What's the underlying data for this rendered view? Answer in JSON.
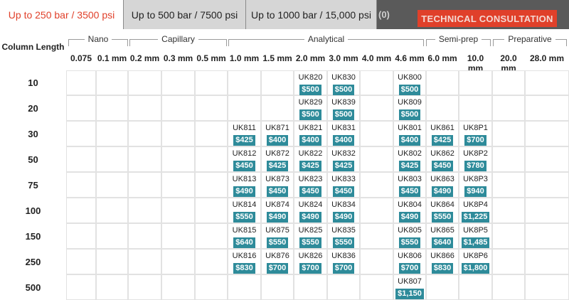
{
  "tabs": [
    {
      "label": "Up to 250 bar / 3500 psi",
      "active": true
    },
    {
      "label": "Up to 500 bar / 7500 psi",
      "active": false
    },
    {
      "label": "Up to 1000 bar / 15,000 psi",
      "active": false
    }
  ],
  "cart_count": "(0)",
  "consult_button": "TECHNICAL CONSULTATION",
  "column_length_label": "Column Length",
  "groups": [
    {
      "label": "Nano"
    },
    {
      "label": "Capillary"
    },
    {
      "label": "Analytical"
    },
    {
      "label": "Semi-prep"
    },
    {
      "label": "Preparative"
    }
  ],
  "columns": [
    "0.075",
    "0.1 mm",
    "0.2 mm",
    "0.3 mm",
    "0.5 mm",
    "1.0 mm",
    "1.5 mm",
    "2.0 mm",
    "3.0 mm",
    "4.0 mm",
    "4.6 mm",
    "6.0 mm",
    "10.0 mm",
    "20.0 mm",
    "28.0 mm"
  ],
  "price_color": "#2e8b9a",
  "accent_color": "#e0402a",
  "rows": [
    {
      "length": "10",
      "cells": [
        null,
        null,
        null,
        null,
        null,
        null,
        null,
        {
          "code": "UK820",
          "price": "$500"
        },
        {
          "code": "UK830",
          "price": "$500"
        },
        null,
        {
          "code": "UK800",
          "price": "$500"
        },
        null,
        null,
        null,
        null
      ]
    },
    {
      "length": "20",
      "cells": [
        null,
        null,
        null,
        null,
        null,
        null,
        null,
        {
          "code": "UK829",
          "price": "$500"
        },
        {
          "code": "UK839",
          "price": "$500"
        },
        null,
        {
          "code": "UK809",
          "price": "$500"
        },
        null,
        null,
        null,
        null
      ]
    },
    {
      "length": "30",
      "cells": [
        null,
        null,
        null,
        null,
        null,
        {
          "code": "UK811",
          "price": "$425"
        },
        {
          "code": "UK871",
          "price": "$400"
        },
        {
          "code": "UK821",
          "price": "$400"
        },
        {
          "code": "UK831",
          "price": "$400"
        },
        null,
        {
          "code": "UK801",
          "price": "$400"
        },
        {
          "code": "UK861",
          "price": "$425"
        },
        {
          "code": "UK8P1",
          "price": "$700"
        },
        null,
        null
      ]
    },
    {
      "length": "50",
      "cells": [
        null,
        null,
        null,
        null,
        null,
        {
          "code": "UK812",
          "price": "$450"
        },
        {
          "code": "UK872",
          "price": "$425"
        },
        {
          "code": "UK822",
          "price": "$425"
        },
        {
          "code": "UK832",
          "price": "$425"
        },
        null,
        {
          "code": "UK802",
          "price": "$425"
        },
        {
          "code": "UK862",
          "price": "$450"
        },
        {
          "code": "UK8P2",
          "price": "$780"
        },
        null,
        null
      ]
    },
    {
      "length": "75",
      "cells": [
        null,
        null,
        null,
        null,
        null,
        {
          "code": "UK813",
          "price": "$490"
        },
        {
          "code": "UK873",
          "price": "$450"
        },
        {
          "code": "UK823",
          "price": "$450"
        },
        {
          "code": "UK833",
          "price": "$450"
        },
        null,
        {
          "code": "UK803",
          "price": "$450"
        },
        {
          "code": "UK863",
          "price": "$490"
        },
        {
          "code": "UK8P3",
          "price": "$940"
        },
        null,
        null
      ]
    },
    {
      "length": "100",
      "cells": [
        null,
        null,
        null,
        null,
        null,
        {
          "code": "UK814",
          "price": "$550"
        },
        {
          "code": "UK874",
          "price": "$490"
        },
        {
          "code": "UK824",
          "price": "$490"
        },
        {
          "code": "UK834",
          "price": "$490"
        },
        null,
        {
          "code": "UK804",
          "price": "$490"
        },
        {
          "code": "UK864",
          "price": "$550"
        },
        {
          "code": "UK8P4",
          "price": "$1,225"
        },
        null,
        null
      ]
    },
    {
      "length": "150",
      "cells": [
        null,
        null,
        null,
        null,
        null,
        {
          "code": "UK815",
          "price": "$640"
        },
        {
          "code": "UK875",
          "price": "$550"
        },
        {
          "code": "UK825",
          "price": "$550"
        },
        {
          "code": "UK835",
          "price": "$550"
        },
        null,
        {
          "code": "UK805",
          "price": "$550"
        },
        {
          "code": "UK865",
          "price": "$640"
        },
        {
          "code": "UK8P5",
          "price": "$1,485"
        },
        null,
        null
      ]
    },
    {
      "length": "250",
      "cells": [
        null,
        null,
        null,
        null,
        null,
        {
          "code": "UK816",
          "price": "$830"
        },
        {
          "code": "UK876",
          "price": "$700"
        },
        {
          "code": "UK826",
          "price": "$700"
        },
        {
          "code": "UK836",
          "price": "$700"
        },
        null,
        {
          "code": "UK806",
          "price": "$700"
        },
        {
          "code": "UK866",
          "price": "$830"
        },
        {
          "code": "UK8P6",
          "price": "$1,800"
        },
        null,
        null
      ]
    },
    {
      "length": "500",
      "cells": [
        null,
        null,
        null,
        null,
        null,
        null,
        null,
        null,
        null,
        null,
        {
          "code": "UK807",
          "price": "$1,150"
        },
        null,
        null,
        null,
        null
      ]
    }
  ]
}
